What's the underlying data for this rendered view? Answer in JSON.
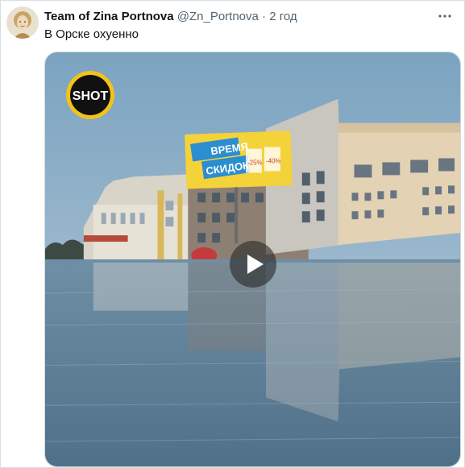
{
  "tweet": {
    "author": {
      "display_name": "Team of Zina Portnova",
      "handle": "@Zn_Portnova",
      "separator": "·",
      "time_ago": "2 год"
    },
    "text": "В Орскe охуенно",
    "more_icon": "more-horizontal-icon"
  },
  "media": {
    "type": "video",
    "logo_text": "SHOT",
    "billboard": {
      "line1": "ВРЕМЯ",
      "line2": "СКИДОК",
      "percent1": "-25%",
      "percent2": "-40%"
    },
    "play_icon": "play-icon"
  },
  "colors": {
    "name": "#0f1419",
    "secondary": "#536471",
    "sky": "#7fa6c0",
    "water": "#5d7f97",
    "billboard_yellow": "#f4d23a",
    "billboard_blue": "#2a8ed0"
  }
}
